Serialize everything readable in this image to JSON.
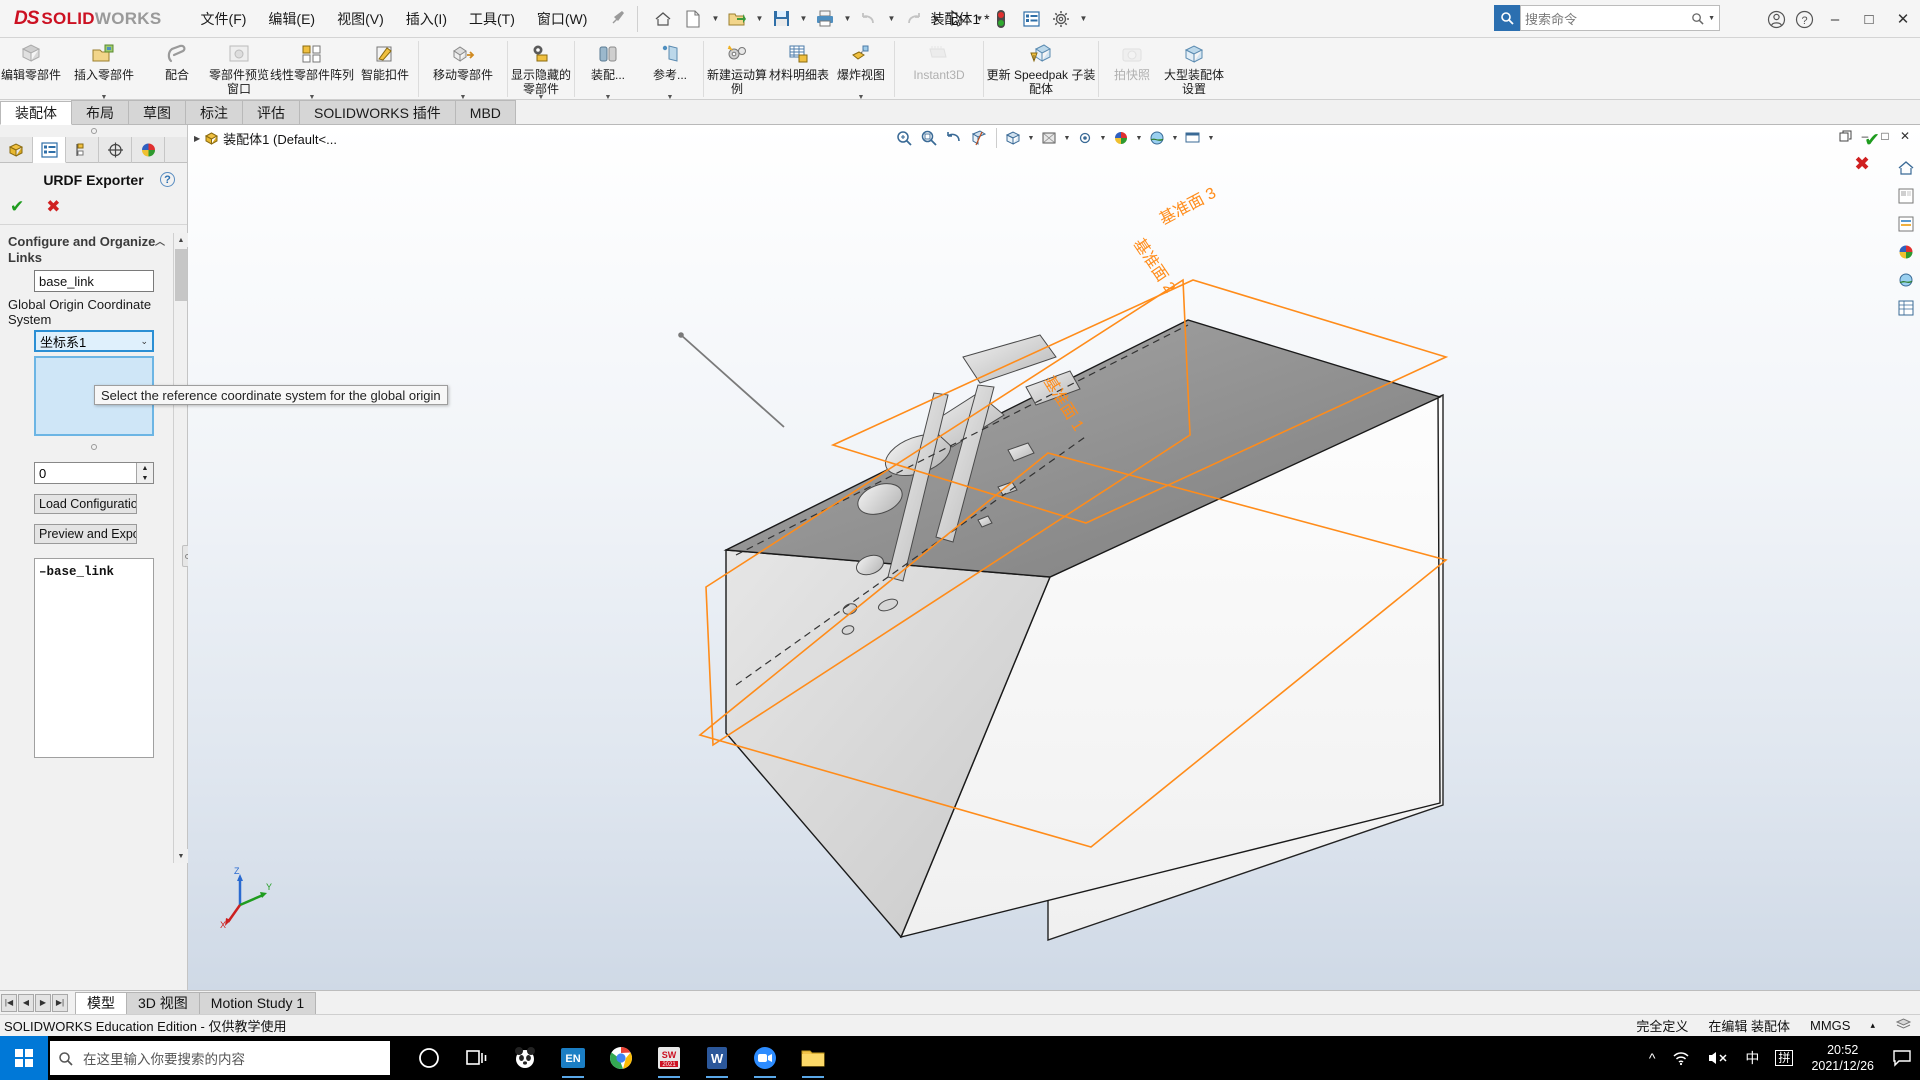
{
  "titlebar": {
    "logo": {
      "ds": "DS",
      "solid": "SOLID",
      "works": "WORKS"
    },
    "menus": [
      "文件(F)",
      "编辑(E)",
      "视图(V)",
      "插入(I)",
      "工具(T)",
      "窗口(W)"
    ],
    "pin_icon": "pin-icon",
    "quick_access": [
      "home-icon",
      "new-doc-icon",
      "open-icon",
      "save-icon",
      "print-icon",
      "undo-icon",
      "redo-icon",
      "select-icon",
      "rebuild-icon",
      "options-list-icon",
      "settings-gear-icon"
    ],
    "document_title": "装配体1 *",
    "search": {
      "placeholder": "搜索命令",
      "icon": "search-icon"
    },
    "account_icon": "account-icon",
    "help_icon": "help-icon",
    "window_controls": {
      "minimize": "–",
      "maximize": "□",
      "close": "✕"
    }
  },
  "ribbon": {
    "items": [
      {
        "label": "编辑零部件",
        "icon": "edit-component-icon",
        "disabled": true,
        "caret": false,
        "width": ""
      },
      {
        "label": "插入零部件",
        "icon": "insert-component-icon",
        "disabled": false,
        "caret": true,
        "width": "wide"
      },
      {
        "label": "配合",
        "icon": "mate-icon",
        "disabled": false,
        "caret": false,
        "width": ""
      },
      {
        "label": "零部件预览窗口",
        "icon": "component-preview-icon",
        "disabled": true,
        "caret": false,
        "width": ""
      },
      {
        "label": "线性零部件阵列",
        "icon": "linear-pattern-icon",
        "disabled": false,
        "caret": true,
        "width": "wide"
      },
      {
        "label": "智能扣件",
        "icon": "smart-fastener-icon",
        "disabled": false,
        "caret": false,
        "width": ""
      },
      {
        "label": "移动零部件",
        "icon": "move-component-icon",
        "disabled": false,
        "caret": true,
        "width": "wide"
      },
      {
        "label": "显示隐藏的零部件",
        "icon": "show-hidden-components-icon",
        "disabled": false,
        "caret": true,
        "width": ""
      },
      {
        "label": "装配...",
        "icon": "assembly-features-icon",
        "disabled": false,
        "caret": true,
        "width": ""
      },
      {
        "label": "参考...",
        "icon": "reference-geometry-icon",
        "disabled": false,
        "caret": true,
        "width": ""
      },
      {
        "label": "新建运动算例",
        "icon": "new-motion-study-icon",
        "disabled": false,
        "caret": false,
        "width": ""
      },
      {
        "label": "材料明细表",
        "icon": "bill-of-materials-icon",
        "disabled": false,
        "caret": false,
        "width": ""
      },
      {
        "label": "爆炸视图",
        "icon": "exploded-view-icon",
        "disabled": false,
        "caret": true,
        "width": ""
      },
      {
        "label": "Instant3D",
        "icon": "instant3d-icon",
        "disabled": true,
        "caret": false,
        "width": "wide"
      },
      {
        "label": "更新 Speedpak 子装配体",
        "icon": "update-speedpak-icon",
        "disabled": false,
        "caret": false,
        "width": "xwide"
      },
      {
        "label": "拍快照",
        "icon": "take-snapshot-icon",
        "disabled": true,
        "caret": false,
        "width": ""
      },
      {
        "label": "大型装配体设置",
        "icon": "large-assembly-settings-icon",
        "disabled": false,
        "caret": false,
        "width": ""
      }
    ]
  },
  "tabs": {
    "items": [
      "装配体",
      "布局",
      "草图",
      "标注",
      "评估",
      "SOLIDWORKS 插件",
      "MBD"
    ],
    "active_index": 0
  },
  "left_panel": {
    "tab_icons": [
      "feature-manager-icon",
      "property-manager-icon",
      "configuration-manager-icon",
      "dimxpert-manager-icon",
      "appearances-icon"
    ],
    "active_tab_index": 1,
    "title": "URDF Exporter",
    "help_icon": "help-icon",
    "ok_icon": "✔",
    "cancel_icon": "✖",
    "section_title": "Configure and Organize Links",
    "link_name_value": "base_link",
    "link_name_placeholder": "base_link",
    "coordinate_label": "Global Origin Coordinate System",
    "coordinate_value": "坐标系1",
    "axis_value": "0",
    "load_config_button": "Load Configuration..",
    "preview_export_button": "Preview and Export..",
    "tree_items": [
      "base_link"
    ],
    "tooltip": "Select the reference coordinate system for the global origin"
  },
  "graphics": {
    "feature_tree_root": "装配体1  (Default<...",
    "toolbar_icons": [
      "zoom-to-fit-icon",
      "zoom-to-area-icon",
      "previous-view-icon",
      "section-view-icon",
      "view-orientation-icon",
      "display-style-icon",
      "hide-show-icon",
      "edit-appearance-icon",
      "apply-scene-icon",
      "view-settings-icon"
    ],
    "right_rail_icons": [
      "home-view-icon",
      "view-palette-icon",
      "appearances-panel-icon",
      "scenes-panel-icon",
      "decals-panel-icon",
      "custom-properties-icon"
    ],
    "triad_axes": {
      "x": "X",
      "y": "Y",
      "z": "Z"
    },
    "model_labels": [
      "基准面 2",
      "基准面 1",
      "基准面 3"
    ]
  },
  "bottom_tabs": {
    "nav_icons": [
      "first-icon",
      "prev-icon",
      "next-icon",
      "last-icon"
    ],
    "items": [
      "模型",
      "3D 视图",
      "Motion Study 1"
    ],
    "active_index": 0
  },
  "status_bar": {
    "left_text": "SOLIDWORKS Education Edition - 仅供教学使用",
    "state_text": "完全定义",
    "edit_text": "在编辑 装配体",
    "units": "MMGS",
    "units_caret": "▴",
    "overlay_icon": "layers-icon"
  },
  "taskbar": {
    "start_icon": "windows-start-icon",
    "search_placeholder": "在这里输入你要搜索的内容",
    "search_icon": "search-icon",
    "pinned": [
      "cortana-icon",
      "task-view-icon",
      "panda-antivirus-icon",
      "english-ime-icon",
      "chrome-icon",
      "solidworks-icon",
      "word-icon",
      "zoom-icon",
      "file-explorer-icon"
    ],
    "tray": {
      "chevron": "^",
      "network_icon": "wifi-icon",
      "volume_icon": "volume-muted-icon",
      "ime_lang": "中",
      "ime_mode": "拼",
      "time": "20:52",
      "date": "2021/12/26",
      "action_center_icon": "notifications-icon"
    }
  }
}
